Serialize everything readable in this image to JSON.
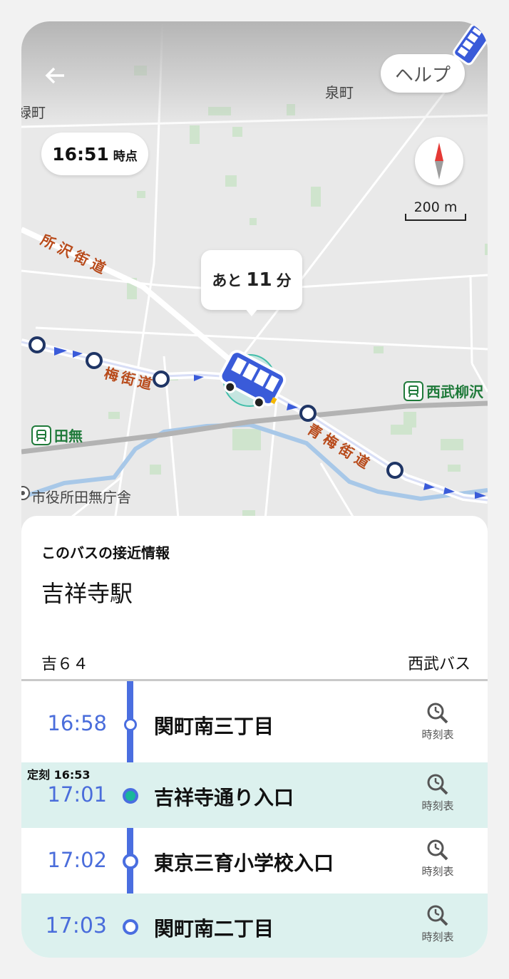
{
  "header": {
    "help_label": "ヘルプ"
  },
  "map": {
    "time": "16:51",
    "time_unit": "時点",
    "scale_label": "200 m",
    "eta_prefix": "あと",
    "eta_minutes": "11",
    "eta_suffix": "分",
    "labels": {
      "izumicho": "泉町",
      "midoricho": "緑町",
      "tokorozawa_kaido": "所沢街道",
      "ome_kaido_1": "梅街道",
      "ome_kaido_2": "青梅街道",
      "city_hall": "市役所田無庁舎"
    },
    "stations": {
      "seibu_yagisawa": "西武柳沢",
      "tanashi": "田無"
    },
    "colors": {
      "route": "#3a5bd9",
      "current_stop": "#19b79a",
      "station": "#1f7a3a",
      "water": "#a8c8e8"
    }
  },
  "panel": {
    "subtitle": "このバスの接近情報",
    "destination": "吉祥寺駅",
    "route_name": "吉６４",
    "company": "西武バス",
    "timetable_label": "時刻表",
    "stops": [
      {
        "time": "16:58",
        "name": "関町南三丁目",
        "scheduled": ""
      },
      {
        "time": "17:01",
        "name": "吉祥寺通り入口",
        "scheduled": "定刻 16:53"
      },
      {
        "time": "17:02",
        "name": "東京三育小学校入口",
        "scheduled": ""
      },
      {
        "time": "17:03",
        "name": "関町南二丁目",
        "scheduled": ""
      }
    ]
  }
}
